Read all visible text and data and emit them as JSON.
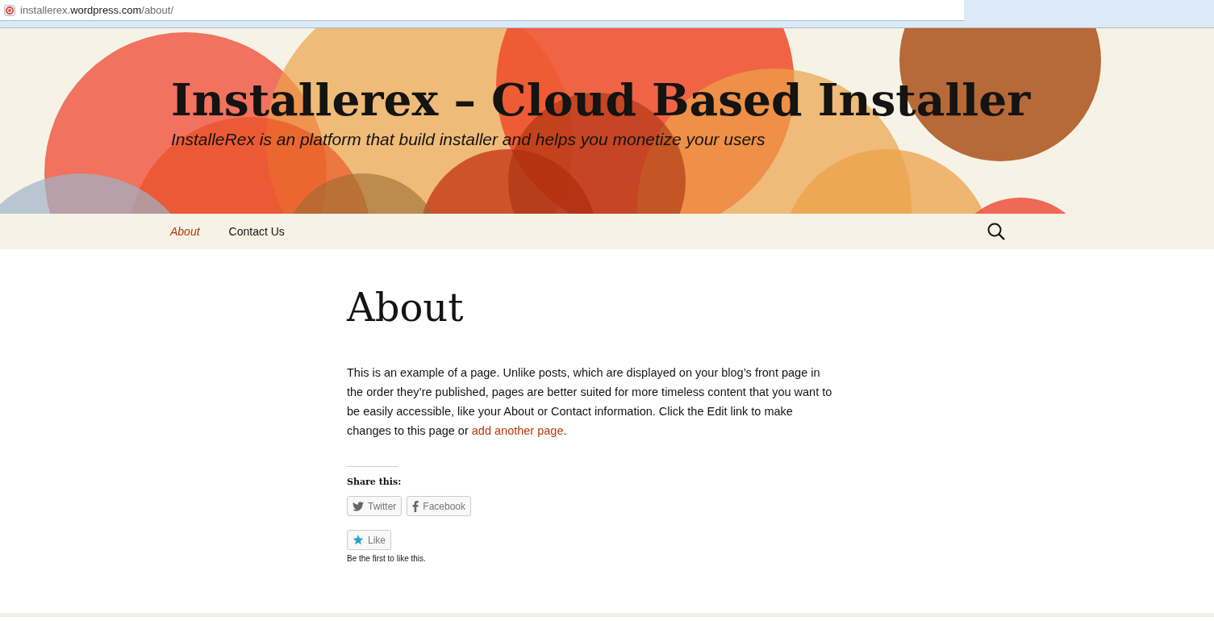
{
  "address_bar": {
    "url": "installerex.**wordpress.com**/about/"
  },
  "site": {
    "title": "Installerex – Cloud Based Installer",
    "tagline": "InstalleRex is an platform that build installer and helps you monetize your users"
  },
  "nav": {
    "items": [
      {
        "label": "About",
        "selected": true
      },
      {
        "label": "Contact Us",
        "selected": false
      }
    ]
  },
  "page": {
    "title": "About",
    "body": {
      "text": "This is an example of a page. Unlike posts, which are displayed on your blog’s front page in the order they’re published, pages are better suited for more timeless content that you want to be easily accessible, like your About or Contact information. Click the Edit link to make changes to this page or ",
      "link": "add another page",
      "end": "."
    }
  },
  "share": {
    "heading": "Share this:",
    "buttons": [
      {
        "kind": "twitter",
        "label": "Twitter"
      },
      {
        "kind": "facebook",
        "label": "Facebook"
      }
    ]
  },
  "like": {
    "button": "Like",
    "note": "Be the first to like this."
  }
}
